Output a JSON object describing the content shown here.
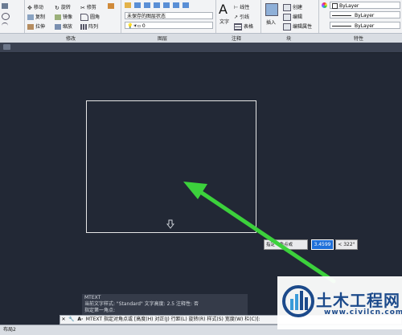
{
  "ribbon": {
    "modify": {
      "move": "移动",
      "rotate": "旋转",
      "trim": "修剪",
      "copy": "复制",
      "mirror": "镜像",
      "fillet": "圆角",
      "stretch": "拉伸",
      "scale": "缩放",
      "array": "阵列",
      "panel_label": "修改"
    },
    "layer": {
      "state": "未保存的图层状态",
      "current": "0",
      "panel_label": "图层"
    },
    "annotation": {
      "text": "文字",
      "linear": "线性",
      "leader": "引线",
      "table": "表格",
      "panel_label": "注释"
    },
    "block": {
      "insert": "插入",
      "create": "创建",
      "edit": "编辑",
      "edit_attr": "编辑属性",
      "panel_label": "块"
    },
    "properties": {
      "color": "ByLayer",
      "linetype": "ByLayer",
      "lineweight": "ByLayer",
      "panel_label": "特性"
    }
  },
  "canvas": {
    "tooltip_prompt": "指定一角点或",
    "tooltip_value": "3.4599",
    "tooltip_angle": "< 322°"
  },
  "history": {
    "line1": "MTEXT",
    "line2": "当前文字样式: \"Standard\"  文字高度: 2.5  注释性: 否",
    "line3": "指定第一角点:"
  },
  "command": {
    "prompt": "MTEXT 指定对角点或 [高度(H) 对正(J) 行距(L) 旋转(R) 样式(S) 宽度(W) 栏(C)]:"
  },
  "status": {
    "layout": "布局2"
  },
  "watermark": {
    "cn": "土木工程网",
    "url": "www.civilcn.com"
  },
  "colors": {
    "canvas_bg": "#222835",
    "arrow": "#3cd13c",
    "accent": "#1e6fd9"
  }
}
